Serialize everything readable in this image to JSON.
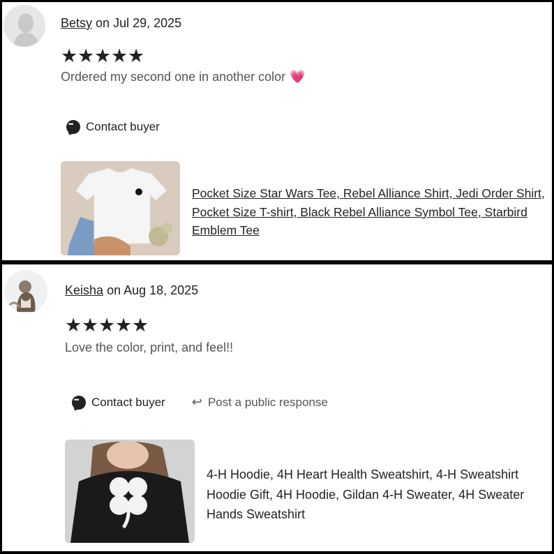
{
  "reviews": [
    {
      "reviewer": "Betsy",
      "date_text": "on Jul 29, 2025",
      "stars": [
        "★",
        "★",
        "★",
        "★",
        "★"
      ],
      "rating": 5,
      "text": "Ordered my second one in another color",
      "emoji": "💗",
      "actions": {
        "contact": "Contact buyer"
      },
      "product_lines": [
        "Pocket Size Star Wars Tee, Rebel Alliance Shirt, Jedi Order Shirt,",
        "Pocket Size T-shirt, Black Rebel Alliance Symbol Tee, Starbird",
        "Emblem Tee"
      ]
    },
    {
      "reviewer": "Keisha",
      "date_text": "on Aug 18, 2025",
      "stars": [
        "★",
        "★",
        "★",
        "★",
        "★"
      ],
      "rating": 5,
      "text": "Love the color, print, and feel!!",
      "actions": {
        "contact": "Contact buyer",
        "respond": "Post a public response"
      },
      "product_lines": [
        "4-H Hoodie, 4H Heart Health Sweatshirt, 4-H Sweatshirt",
        "Hoodie Gift, 4H Hoodie, Gildan 4-H Sweater, 4H Sweater",
        "Hands Sweatshirt"
      ]
    }
  ],
  "icons": {
    "contact": "chat-bubble-icon",
    "respond": "reply-arrow-icon",
    "rating": "star-icon"
  },
  "colors": {
    "text": "#222222",
    "muted": "#555555",
    "heart": "#e8448f",
    "frame": "#000000"
  }
}
